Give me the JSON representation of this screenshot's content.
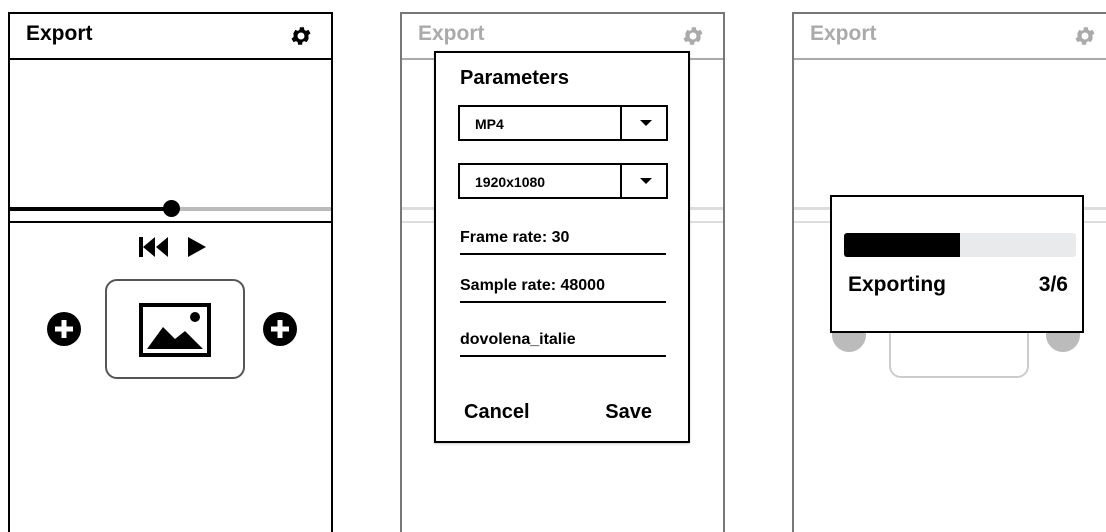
{
  "screen1": {
    "title": "Export",
    "timeline_position": 0.5
  },
  "screen2": {
    "title": "Export",
    "dialog": {
      "title": "Parameters",
      "format_select": "MP4",
      "resolution_select": "1920x1080",
      "frame_rate": "Frame rate: 30",
      "sample_rate": "Sample rate: 48000",
      "filename": "dovolena_italie",
      "cancel_label": "Cancel",
      "save_label": "Save"
    }
  },
  "screen3": {
    "title": "Export",
    "progress": {
      "label": "Exporting",
      "count": "3/6",
      "fraction": 0.5
    }
  },
  "icons": [
    "gear-icon",
    "rewind-icon",
    "play-icon",
    "image-icon",
    "add-icon",
    "chevron-down-icon"
  ],
  "colors": {
    "primary": "#000000",
    "faded_text": "#aaaaaa",
    "progress_track": "#e8eaec"
  }
}
